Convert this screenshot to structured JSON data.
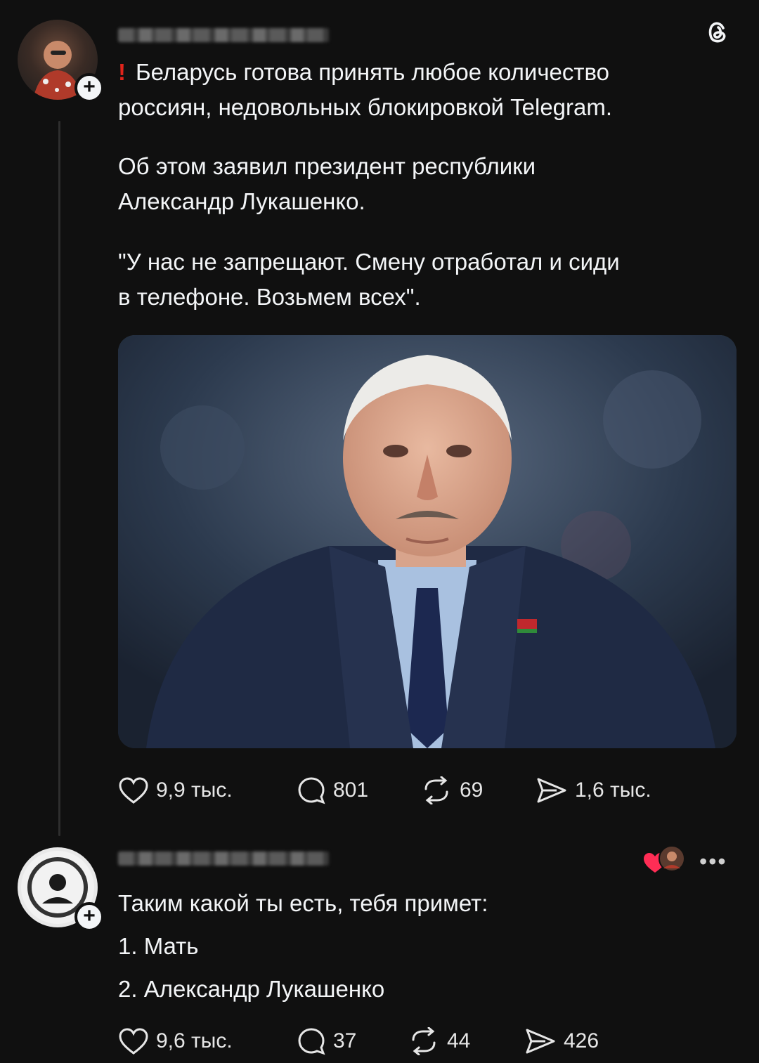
{
  "app": {
    "accent": "#e0241b",
    "background": "#101010"
  },
  "post": {
    "alert_icon": "!",
    "text_line1": "Беларусь готова принять любое количество",
    "text_line2": "россиян, недовольных блокировкой Telegram.",
    "paragraph2_line1": "Об этом заявил президент республики",
    "paragraph2_line2": "Александр Лукашенко.",
    "paragraph3_line1": "\"У нас не запрещают. Смену отработал и сиди",
    "paragraph3_line2": "в телефоне. Возьмем всех\".",
    "stats": {
      "likes": "9,9 тыс.",
      "replies": "801",
      "reposts": "69",
      "shares": "1,6 тыс."
    }
  },
  "reply": {
    "line1": "Таким какой ты есть, тебя примет:",
    "line2": "1. Мать",
    "line3": "2. Александр Лукашенко",
    "stats": {
      "likes": "9,6 тыс.",
      "replies": "37",
      "reposts": "44",
      "shares": "426"
    }
  }
}
